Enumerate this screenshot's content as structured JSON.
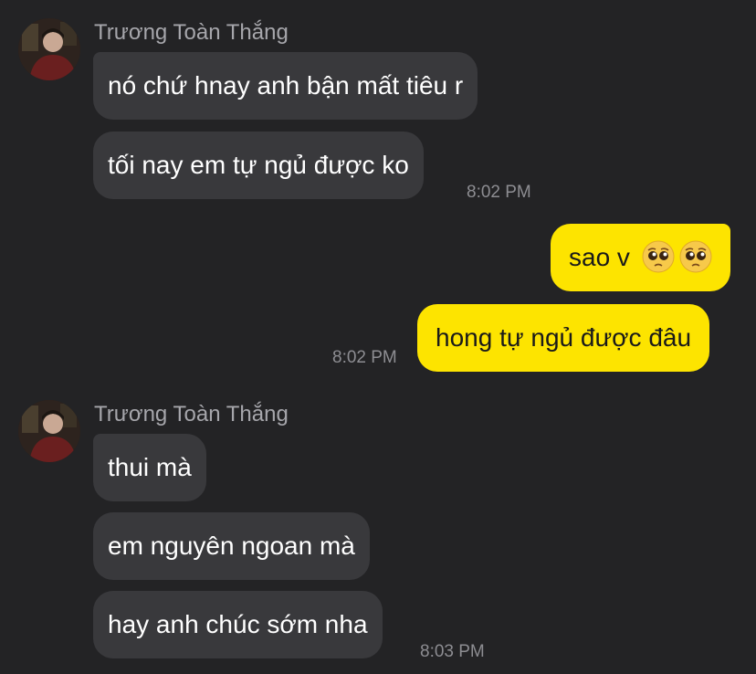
{
  "groups": [
    {
      "sender": "Trương Toàn Thắng",
      "messages": [
        "nó chứ hnay anh bận mất tiêu r",
        "tối nay em tự ngủ được ko"
      ],
      "time": "8:02 PM"
    },
    {
      "messages": [
        "sao v",
        "hong tự ngủ được đâu"
      ],
      "emojis": [
        "pleading-face-icon",
        "pleading-face-icon"
      ],
      "time": "8:02 PM"
    },
    {
      "sender": "Trương Toàn Thắng",
      "messages": [
        "thui mà",
        "em nguyên ngoan mà",
        "hay anh chúc sớm nha"
      ],
      "time": "8:03 PM"
    }
  ],
  "colors": {
    "background": "#232325",
    "incoming_bubble": "#39393c",
    "outgoing_bubble": "#fde400",
    "sender_name": "#a6a6ab",
    "timestamp": "#8d8d92"
  }
}
